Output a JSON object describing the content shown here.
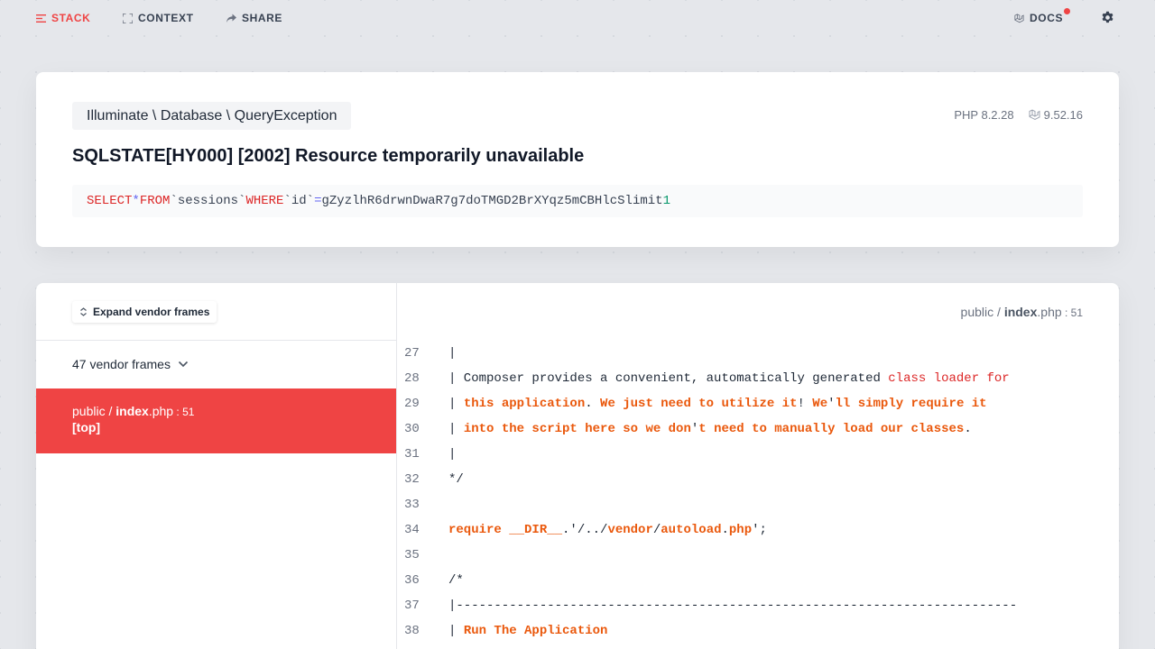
{
  "nav": {
    "stack": "STACK",
    "context": "CONTEXT",
    "share": "SHARE",
    "docs": "DOCS"
  },
  "header": {
    "exception_class": "Illuminate \\ Database \\ QueryException",
    "php_version": "PHP 8.2.28",
    "laravel_version": "9.52.16",
    "message": "SQLSTATE[HY000] [2002] Resource temporarily unavailable",
    "sql": {
      "select": "SELECT",
      "star": "*",
      "from": "FROM",
      "table": "`sessions`",
      "where": "WHERE",
      "column": "`id`",
      "equals": "=",
      "value": "gZyzlhR6drwnDwaR7g7doTMGD2BrXYqz5mCBHlcS",
      "limit": "limit",
      "limit_value": "1"
    }
  },
  "sidebar": {
    "expand_button": "Expand vendor frames",
    "vendor_frames": "47 vendor frames",
    "active_frame": {
      "dir": "public",
      "sep": " / ",
      "file": "index",
      "ext": ".php",
      "line": " : 51",
      "label": "[top]"
    }
  },
  "code": {
    "file": {
      "dir": "public",
      "sep": " / ",
      "name": "index",
      "ext": ".php",
      "line": " : 51"
    },
    "lines": [
      {
        "no": "27"
      },
      {
        "no": "28"
      },
      {
        "no": "29"
      },
      {
        "no": "30"
      },
      {
        "no": "31"
      },
      {
        "no": "32"
      },
      {
        "no": "33"
      },
      {
        "no": "34"
      },
      {
        "no": "35"
      },
      {
        "no": "36"
      },
      {
        "no": "37"
      },
      {
        "no": "38"
      }
    ],
    "tokens": {
      "l27": "|",
      "l28a": "| Composer provides a convenient, automatically generated ",
      "l28b": "class loader for",
      "l29a": "| ",
      "l29b": "this application",
      "l29c": ". ",
      "l29d": "We just need to utilize it",
      "l29e": "! ",
      "l29f": "We",
      "l29g": "'",
      "l29h": "ll simply require it",
      "l30a": "| ",
      "l30b": "into the script here so we don",
      "l30c": "'",
      "l30d": "t need to manually load our classes",
      "l30e": ".",
      "l31": "|",
      "l32": "*/",
      "l33": "",
      "l34a": "require __DIR__",
      "l34b": ".'/../",
      "l34c": "vendor",
      "l34d": "/",
      "l34e": "autoload",
      "l34f": ".",
      "l34g": "php",
      "l34h": "';",
      "l35": "",
      "l36": "/*",
      "l37": "|--------------------------------------------------------------------------",
      "l38a": "| ",
      "l38b": "Run The Application"
    }
  },
  "colors": {
    "accent": "#ef4444",
    "keyword": "#dc2626",
    "highlight": "#ea580c",
    "number": "#059669",
    "operator": "#6366f1"
  }
}
